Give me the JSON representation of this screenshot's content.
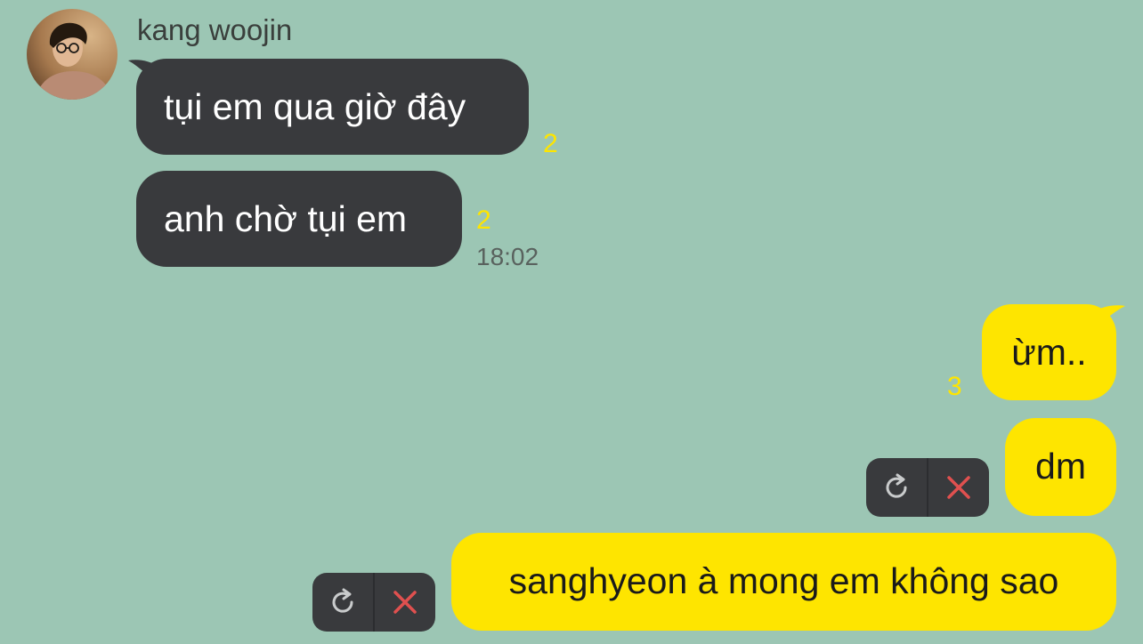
{
  "sender": {
    "name": "kang woojin",
    "avatar_icon": "profile-photo"
  },
  "incoming": [
    {
      "text": "tụi em qua giờ đây",
      "unread": "2"
    },
    {
      "text": "anh chờ tụi em",
      "unread": "2",
      "time": "18:02"
    }
  ],
  "outgoing": [
    {
      "text": "ừm..",
      "unread": "3"
    },
    {
      "text": "dm",
      "status": "failed"
    },
    {
      "text": "sanghyeon à mong em không sao",
      "status": "failed"
    }
  ],
  "fail_actions": {
    "retry_icon": "retry-icon",
    "delete_icon": "close-icon"
  },
  "colors": {
    "background": "#9cc6b4",
    "incoming_bubble": "#393a3d",
    "outgoing_bubble": "#fee500",
    "unread_count": "#fee500",
    "delete_x": "#e0504f"
  }
}
